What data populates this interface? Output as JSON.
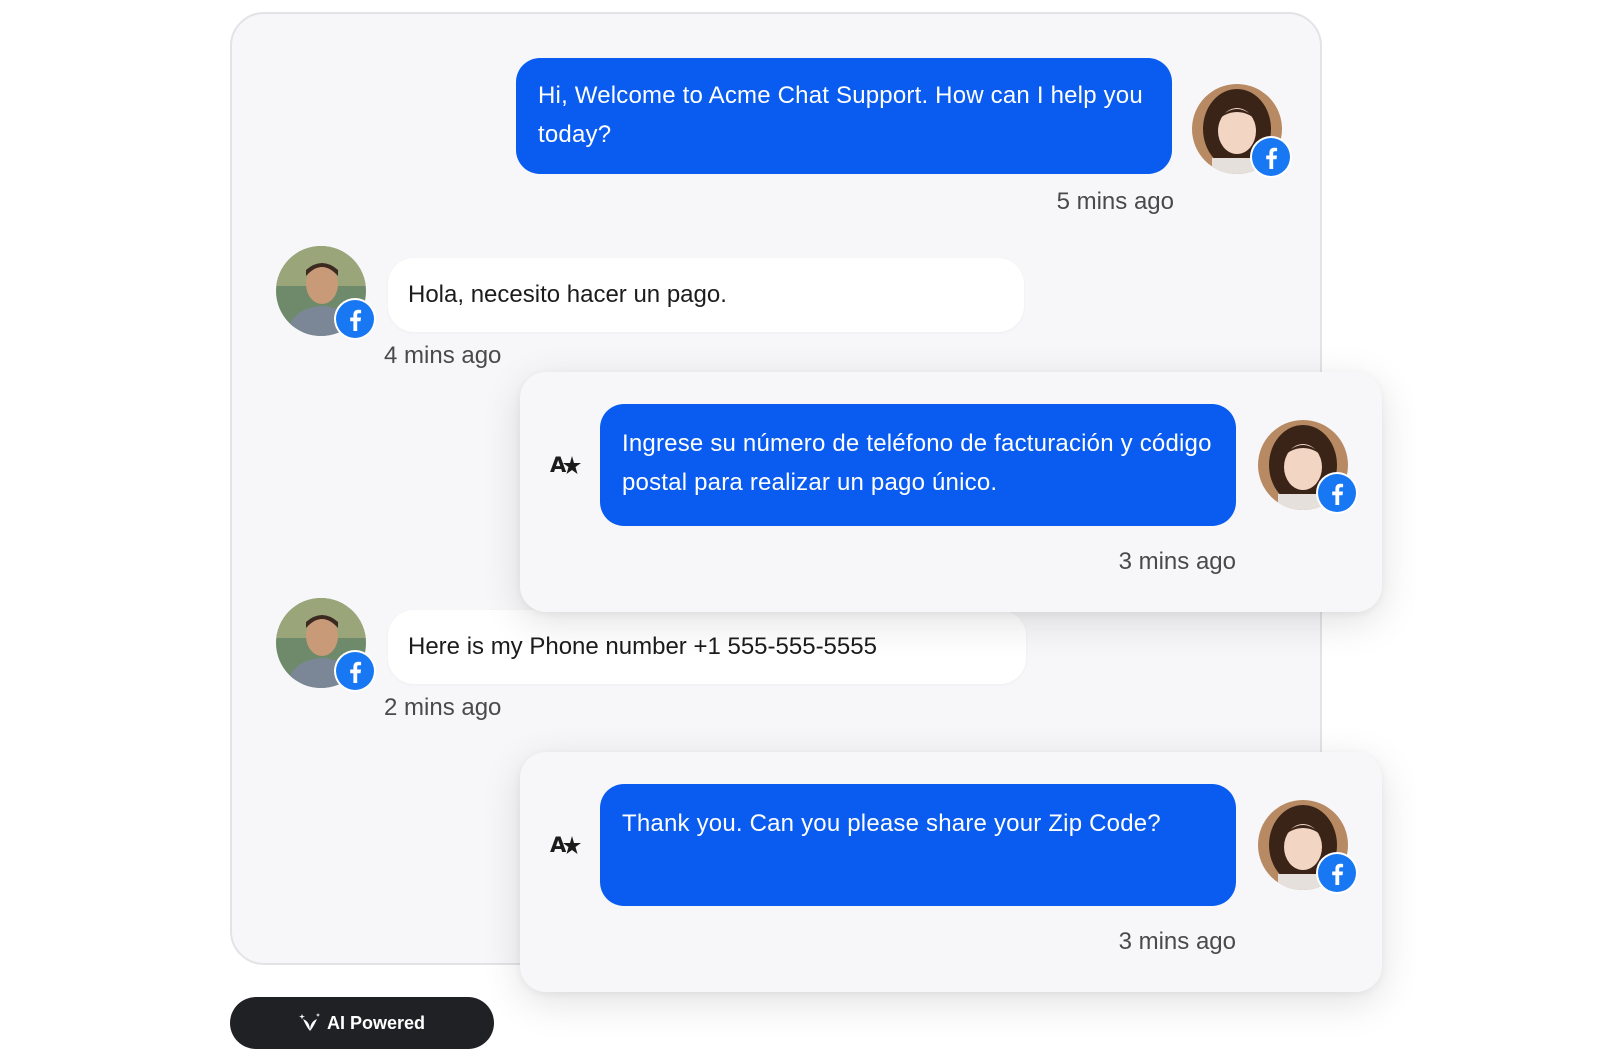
{
  "messages": [
    {
      "sender": "agent",
      "text": "Hi, Welcome to Acme Chat Support. How can I help you today?",
      "time": "5 mins ago",
      "channel": "facebook"
    },
    {
      "sender": "customer",
      "text": "Hola, necesito hacer un pago.",
      "time": "4 mins ago",
      "channel": "facebook"
    },
    {
      "sender": "agent",
      "text": "Ingrese su número de teléfono de facturación y código postal para realizar un pago único.",
      "time": "3 mins ago",
      "channel": "facebook",
      "translated": true
    },
    {
      "sender": "customer",
      "text": "Here is my Phone number +1 555-555-5555",
      "time": "2 mins ago",
      "channel": "facebook"
    },
    {
      "sender": "agent",
      "text": "Thank you. Can you please share your Zip Code?",
      "time": "3 mins ago",
      "channel": "facebook",
      "translated": true
    }
  ],
  "badge": {
    "label": "AI Powered",
    "icon": "sparkle-leaf-icon"
  },
  "icons": {
    "channel": "facebook-icon",
    "translate": "translate-icon"
  },
  "colors": {
    "agent_bubble": "#0a5cf0",
    "customer_bubble": "#ffffff",
    "panel_bg": "#f7f7f9",
    "facebook_blue": "#1877f2",
    "badge_bg": "#1f2125"
  }
}
